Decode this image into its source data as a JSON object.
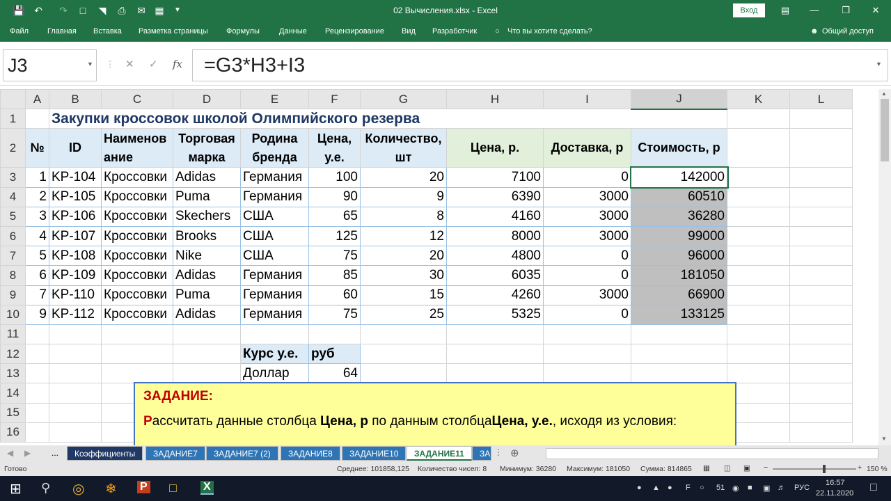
{
  "window": {
    "title": "02 Вычисления.xlsx  -  Excel",
    "signin": "Вход"
  },
  "ribbon": {
    "tabs": [
      "Файл",
      "Главная",
      "Вставка",
      "Разметка страницы",
      "Формулы",
      "Данные",
      "Рецензирование",
      "Вид",
      "Разработчик"
    ],
    "tell": "Что вы хотите сделать?",
    "share": "Общий доступ"
  },
  "formula_bar": {
    "name_box": "J3",
    "formula": "=G3*H3+I3",
    "fx": "fx"
  },
  "columns": [
    "A",
    "B",
    "C",
    "D",
    "E",
    "F",
    "G",
    "H",
    "I",
    "J",
    "K",
    "L"
  ],
  "rows": [
    "1",
    "2",
    "3",
    "4",
    "5",
    "6",
    "7",
    "8",
    "9",
    "10",
    "11",
    "12",
    "13",
    "14",
    "15",
    "16"
  ],
  "sheet": {
    "title": "Закупки кроссовок школой Олимпийского резерва",
    "headers": [
      "№",
      "ID",
      "Наименов ание",
      "Торговая марка",
      "Родина бренда",
      "Цена, у.е.",
      "Количество, шт",
      "Цена, р.",
      "Доставка, р",
      "Стоимость, р"
    ],
    "data": [
      [
        "1",
        "KP-104",
        "Кроссовки",
        "Adidas",
        "Германия",
        "100",
        "20",
        "7100",
        "0",
        "142000"
      ],
      [
        "2",
        "KP-105",
        "Кроссовки",
        "Puma",
        "Германия",
        "90",
        "9",
        "6390",
        "3000",
        "60510"
      ],
      [
        "3",
        "KP-106",
        "Кроссовки",
        "Skechers",
        "США",
        "65",
        "8",
        "4160",
        "3000",
        "36280"
      ],
      [
        "4",
        "KP-107",
        "Кроссовки",
        "Brooks",
        "США",
        "125",
        "12",
        "8000",
        "3000",
        "99000"
      ],
      [
        "5",
        "KP-108",
        "Кроссовки",
        "Nike",
        "США",
        "75",
        "20",
        "4800",
        "0",
        "96000"
      ],
      [
        "6",
        "KP-109",
        "Кроссовки",
        "Adidas",
        "Германия",
        "85",
        "30",
        "6035",
        "0",
        "181050"
      ],
      [
        "7",
        "KP-110",
        "Кроссовки",
        "Puma",
        "Германия",
        "60",
        "15",
        "4260",
        "3000",
        "66900"
      ],
      [
        "9",
        "KP-112",
        "Кроссовки",
        "Adidas",
        "Германия",
        "75",
        "25",
        "5325",
        "0",
        "133125"
      ]
    ],
    "rate": {
      "h1": "Курс у.е.",
      "h2": "руб",
      "l1": "Доллар",
      "v1": "64"
    }
  },
  "task": {
    "heading": "ЗАДАНИЕ:",
    "p1": "Р",
    "p2": "ассчитать данные столбца ",
    "p3": "Цена, р",
    "p4": " по данным столбца",
    "p5": "Цена, у.е.",
    "p6": ", исходя из условия:"
  },
  "tabs": [
    "...",
    "Коэффициенты",
    "ЗАДАНИЕ7",
    "ЗАДАНИЕ7 (2)",
    "ЗАДАНИЕ8",
    "ЗАДАНИЕ10",
    "ЗАДАНИЕ11",
    "ЗА"
  ],
  "status": {
    "ready": "Готово",
    "avg": "Среднее: 101858,125",
    "count": "Количество чисел: 8",
    "min": "Минимум: 36280",
    "max": "Максимум: 181050",
    "sum": "Сумма: 814865",
    "zoom": "150 %"
  },
  "taskbar": {
    "lang": "РУС",
    "time": "16:57",
    "date": "22.11.2020",
    "num": "51"
  }
}
